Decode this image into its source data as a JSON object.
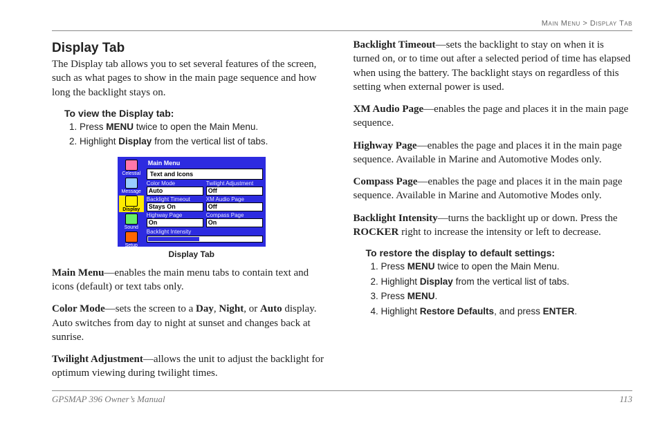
{
  "breadcrumb": {
    "left": "Main Menu",
    "sep": " > ",
    "right": "Display Tab"
  },
  "heading": "Display Tab",
  "intro": "The Display tab allows you to set several features of the screen, such as what pages to show in the main page sequence and how long the backlight stays on.",
  "view": {
    "title": "To view the Display tab:",
    "s1a": "Press ",
    "s1b": "MENU",
    "s1c": " twice to open the Main Menu.",
    "s2a": "Highlight ",
    "s2b": "Display",
    "s2c": " from the vertical list of tabs."
  },
  "device": {
    "title": "Main Menu",
    "panel": "Text and Icons",
    "tabs": [
      "Celestial",
      "Message",
      "Display",
      "Sound",
      "Setup"
    ],
    "rows": [
      [
        {
          "k": "Color Mode",
          "v": "Auto"
        },
        {
          "k": "Twilight Adjustment",
          "v": "Off"
        }
      ],
      [
        {
          "k": "Backlight Timeout",
          "v": "Stays On"
        },
        {
          "k": "XM Audio Page",
          "v": "Off"
        }
      ],
      [
        {
          "k": "Highway Page",
          "v": "On"
        },
        {
          "k": "Compass Page",
          "v": "On"
        }
      ]
    ],
    "intensity": "Backlight Intensity"
  },
  "figcaption": "Display Tab",
  "items": {
    "mainmenu": {
      "t": "Main Menu",
      "b": "—enables the main menu tabs to contain text and icons (default) or text tabs only."
    },
    "colormode": {
      "t": "Color Mode",
      "p1": "—sets the screen to a ",
      "b1": "Day",
      "c1": ", ",
      "b2": "Night",
      "c2": ", or ",
      "b3": "Auto",
      "p2": " display. Auto switches from day to night at sunset and changes back at sunrise."
    },
    "twilight": {
      "t": "Twilight Adjustment",
      "b": "—allows the unit to adjust the backlight for optimum viewing during twilight times."
    },
    "timeout": {
      "t": "Backlight Timeout",
      "b": "—sets the backlight to stay on when it is turned on, or to time out after a selected period of time has elapsed when using the battery. The backlight stays on regardless of this setting when external power is used."
    },
    "xm": {
      "t": "XM Audio Page",
      "b": "—enables the page and places it in the main page sequence."
    },
    "highway": {
      "t": "Highway Page",
      "b": "—enables the page and places it in the main page sequence. Available in Marine and Automotive Modes only."
    },
    "compass": {
      "t": "Compass Page",
      "b": "—enables the page and places it in the main page sequence. Available in Marine and Automotive Modes only."
    },
    "intensity": {
      "t": "Backlight Intensity",
      "p1": "—turns the backlight up or down. Press the ",
      "b1": "ROCKER",
      "p2": " right to increase the intensity or left to decrease."
    }
  },
  "restore": {
    "title": "To restore the display to default settings:",
    "s1a": "Press ",
    "s1b": "MENU",
    "s1c": " twice to open the Main Menu.",
    "s2a": "Highlight ",
    "s2b": "Display",
    "s2c": " from the vertical list of tabs.",
    "s3a": "Press ",
    "s3b": "MENU",
    "s3c": ".",
    "s4a": "Highlight ",
    "s4b": "Restore Defaults",
    "s4c": ", and press ",
    "s4d": "ENTER",
    "s4e": "."
  },
  "footer": {
    "left": "GPSMAP 396 Owner’s Manual",
    "right": "113"
  }
}
